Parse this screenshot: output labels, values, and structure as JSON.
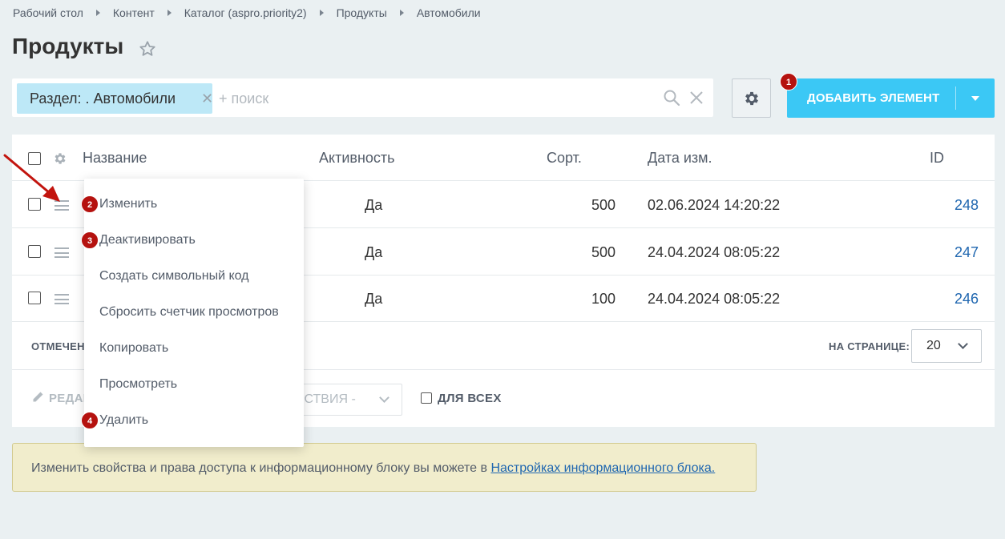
{
  "breadcrumb": [
    "Рабочий стол",
    "Контент",
    "Каталог (aspro.priority2)",
    "Продукты",
    "Автомобили"
  ],
  "page": {
    "title": "Продукты"
  },
  "filter": {
    "tag_label": "Раздел: . Автомобили",
    "placeholder": "+ поиск"
  },
  "toolbar": {
    "add_label": "ДОБАВИТЬ ЭЛЕМЕНТ"
  },
  "markers": [
    "1",
    "2",
    "3",
    "4"
  ],
  "grid": {
    "columns": [
      "Название",
      "Активность",
      "Сорт.",
      "Дата изм.",
      "ID"
    ],
    "rows": [
      {
        "active": "Да",
        "sort": "500",
        "date": "02.06.2024 14:20:22",
        "id": "248"
      },
      {
        "active": "Да",
        "sort": "500",
        "date": "24.04.2024 08:05:22",
        "id": "247"
      },
      {
        "active": "Да",
        "sort": "100",
        "date": "24.04.2024 08:05:22",
        "id": "246"
      }
    ],
    "selected_label": "ОТМЕЧЕН",
    "per_page_label": "НА СТРАНИЦЕ:",
    "per_page_value": "20",
    "edit_label": "РЕДАК",
    "actions_label": "ЙСТВИЯ -",
    "for_all_label": "ДЛЯ ВСЕХ"
  },
  "context_menu": {
    "items": [
      "Изменить",
      "Деактивировать",
      "Создать символьный код",
      "Сбросить счетчик просмотров",
      "Копировать",
      "Просмотреть",
      "Удалить"
    ]
  },
  "info": {
    "text": "Изменить свойства и права доступа к информационному блоку вы можете в ",
    "link": "Настройках информационного блока."
  },
  "colors": {
    "accent": "#3bc8f5",
    "marker": "#b5120f",
    "link": "#2067b0",
    "tag_bg": "#bde8f7",
    "page_bg": "#eaf0f2"
  },
  "icons": [
    "star-icon",
    "search-icon",
    "close-icon",
    "gear-icon",
    "chevron-down-icon",
    "menu-icon",
    "pencil-icon",
    "arrow-icon"
  ]
}
